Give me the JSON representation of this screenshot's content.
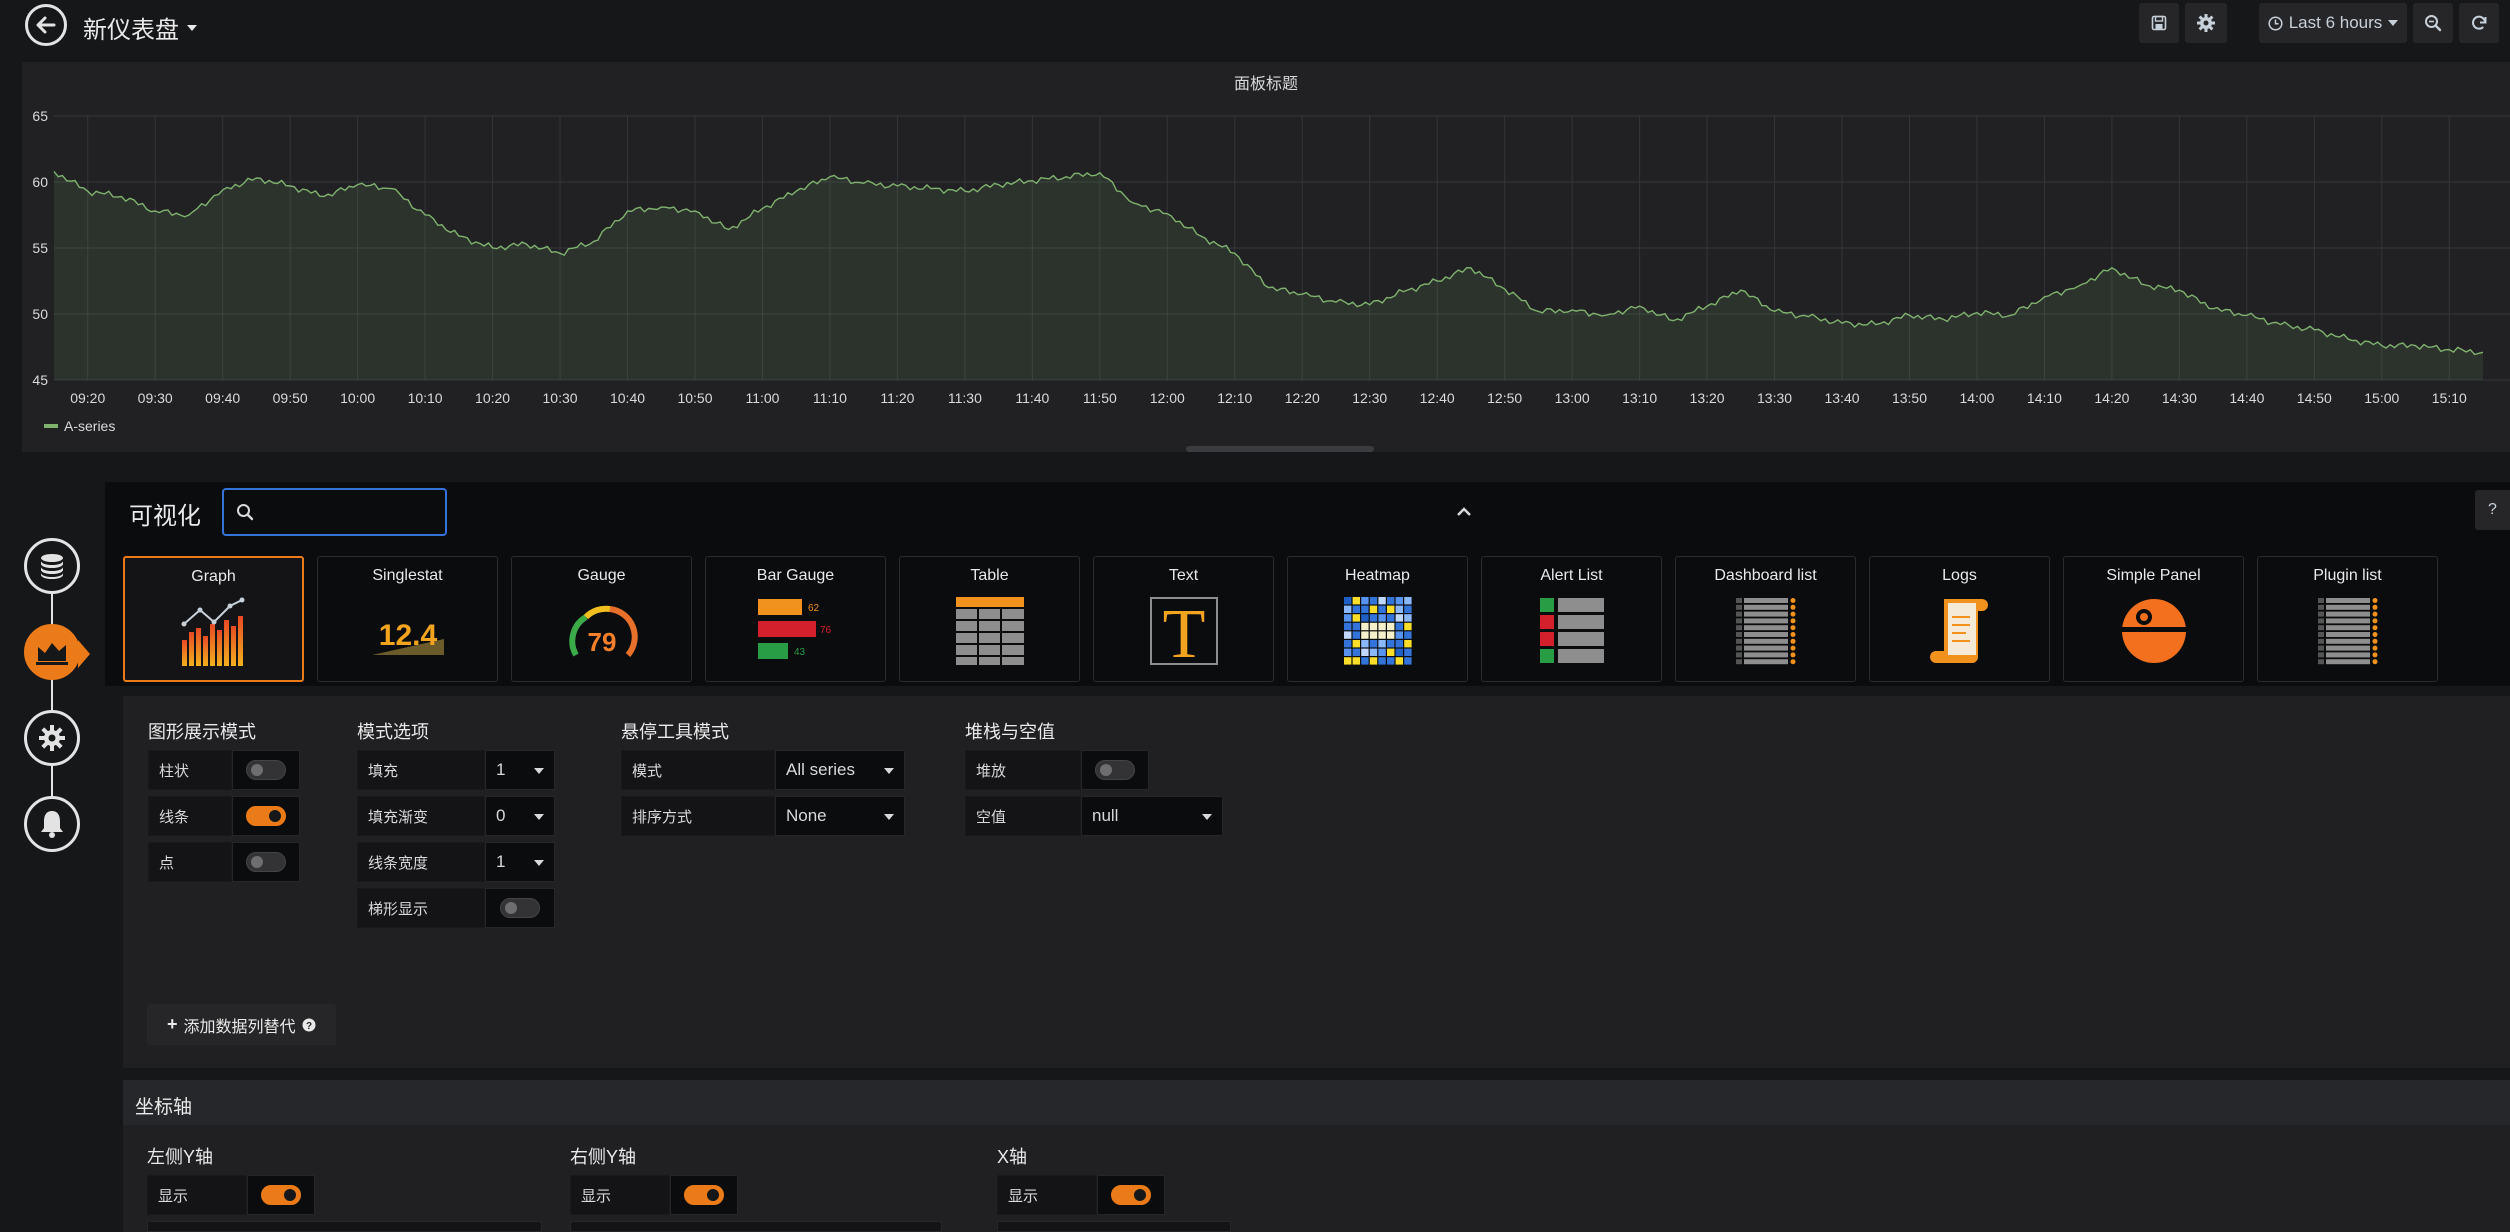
{
  "navbar": {
    "dashboard_title": "新仪表盘",
    "time_range": "Last 6 hours"
  },
  "panel": {
    "title": "面板标题",
    "legend": [
      {
        "name": "A-series",
        "color": "#7eb26d"
      }
    ]
  },
  "chart_data": {
    "type": "area",
    "title": "面板标题",
    "ylim": [
      45,
      65
    ],
    "yticks": [
      "65",
      "60",
      "55",
      "50",
      "45"
    ],
    "xticks": [
      "09:20",
      "09:30",
      "09:40",
      "09:50",
      "10:00",
      "10:10",
      "10:20",
      "10:30",
      "10:40",
      "10:50",
      "11:00",
      "11:10",
      "11:20",
      "11:30",
      "11:40",
      "11:50",
      "12:00",
      "12:10",
      "12:20",
      "12:30",
      "12:40",
      "12:50",
      "13:00",
      "13:10",
      "13:20",
      "13:30",
      "13:40",
      "13:50",
      "14:00",
      "14:10",
      "14:20",
      "14:30",
      "14:40",
      "14:50",
      "15:00",
      "15:10"
    ],
    "grid": true,
    "legend_position": "bottom-left",
    "series": [
      {
        "name": "A-series",
        "color": "#7eb26d",
        "x": [
          "09:15",
          "09:20",
          "09:25",
          "09:30",
          "09:35",
          "09:40",
          "09:45",
          "09:50",
          "09:55",
          "10:00",
          "10:05",
          "10:10",
          "10:15",
          "10:20",
          "10:25",
          "10:30",
          "10:35",
          "10:40",
          "10:45",
          "10:50",
          "10:55",
          "11:00",
          "11:05",
          "11:10",
          "11:15",
          "11:20",
          "11:25",
          "11:30",
          "11:35",
          "11:40",
          "11:45",
          "11:50",
          "11:55",
          "12:00",
          "12:05",
          "12:10",
          "12:15",
          "12:20",
          "12:25",
          "12:30",
          "12:35",
          "12:40",
          "12:45",
          "12:50",
          "12:55",
          "13:00",
          "13:05",
          "13:10",
          "13:15",
          "13:20",
          "13:25",
          "13:30",
          "13:35",
          "13:40",
          "13:45",
          "13:50",
          "13:55",
          "14:00",
          "14:05",
          "14:10",
          "14:15",
          "14:20",
          "14:25",
          "14:30",
          "14:35",
          "14:40",
          "14:45",
          "14:50",
          "14:55",
          "15:00",
          "15:05",
          "15:10",
          "15:15"
        ],
        "values": [
          60.8,
          59.3,
          58.9,
          57.8,
          57.5,
          59.4,
          60.3,
          59.7,
          58.9,
          59.8,
          59.5,
          57.5,
          55.9,
          55.0,
          55.3,
          54.6,
          55.5,
          57.8,
          58.1,
          57.8,
          56.4,
          58.0,
          59.3,
          60.4,
          59.9,
          59.7,
          59.5,
          59.3,
          59.8,
          60.1,
          60.4,
          60.7,
          58.4,
          57.6,
          55.9,
          54.6,
          52.0,
          51.5,
          50.9,
          50.7,
          51.7,
          52.5,
          53.5,
          51.9,
          50.2,
          50.3,
          49.9,
          50.6,
          49.5,
          50.6,
          51.8,
          50.2,
          49.8,
          49.3,
          49.2,
          49.9,
          49.6,
          50.1,
          49.9,
          51.3,
          52.1,
          53.5,
          52.2,
          51.8,
          50.4,
          49.9,
          49.2,
          48.8,
          48.1,
          47.6,
          47.6,
          47.3,
          47.1
        ]
      }
    ]
  },
  "rail": {
    "icons": [
      "database-icon",
      "visualization-icon",
      "gear-icon",
      "bell-icon"
    ]
  },
  "visualization": {
    "title": "可视化",
    "search_placeholder": "",
    "items": [
      {
        "name": "Graph",
        "icon": "graph-icon",
        "selected": true
      },
      {
        "name": "Singlestat",
        "icon": "singlestat-icon",
        "value": "12.4"
      },
      {
        "name": "Gauge",
        "icon": "gauge-icon",
        "value": "79"
      },
      {
        "name": "Bar Gauge",
        "icon": "bar-gauge-icon",
        "values": [
          "62",
          "76",
          "43"
        ]
      },
      {
        "name": "Table",
        "icon": "table-icon"
      },
      {
        "name": "Text",
        "icon": "text-icon",
        "glyph": "T"
      },
      {
        "name": "Heatmap",
        "icon": "heatmap-icon"
      },
      {
        "name": "Alert List",
        "icon": "alert-list-icon"
      },
      {
        "name": "Dashboard list",
        "icon": "dashboard-list-icon"
      },
      {
        "name": "Logs",
        "icon": "logs-icon"
      },
      {
        "name": "Simple Panel",
        "icon": "simple-panel-icon"
      },
      {
        "name": "Plugin list",
        "icon": "plugin-list-icon"
      }
    ]
  },
  "options": {
    "draw_modes": {
      "title": "图形展示模式",
      "bars": {
        "label": "柱状",
        "on": false
      },
      "lines": {
        "label": "线条",
        "on": true
      },
      "points": {
        "label": "点",
        "on": false
      }
    },
    "mode_options": {
      "title": "模式选项",
      "fill": {
        "label": "填充",
        "value": "1"
      },
      "fill_gradient": {
        "label": "填充渐变",
        "value": "0"
      },
      "line_width": {
        "label": "线条宽度",
        "value": "1"
      },
      "staircase": {
        "label": "梯形显示",
        "on": false
      }
    },
    "hover_tooltip": {
      "title": "悬停工具模式",
      "mode": {
        "label": "模式",
        "value": "All series"
      },
      "sort_order": {
        "label": "排序方式",
        "value": "None"
      }
    },
    "stacking": {
      "title": "堆栈与空值",
      "stack": {
        "label": "堆放",
        "on": false
      },
      "null_value": {
        "label": "空值",
        "value": "null"
      }
    },
    "add_override": "添加数据列替代"
  },
  "axes": {
    "title": "坐标轴",
    "left_y": {
      "title": "左侧Y轴",
      "show_label": "显示",
      "show": true
    },
    "right_y": {
      "title": "右侧Y轴",
      "show_label": "显示",
      "show": true
    },
    "x_axis": {
      "title": "X轴",
      "show_label": "显示",
      "show": true
    }
  }
}
